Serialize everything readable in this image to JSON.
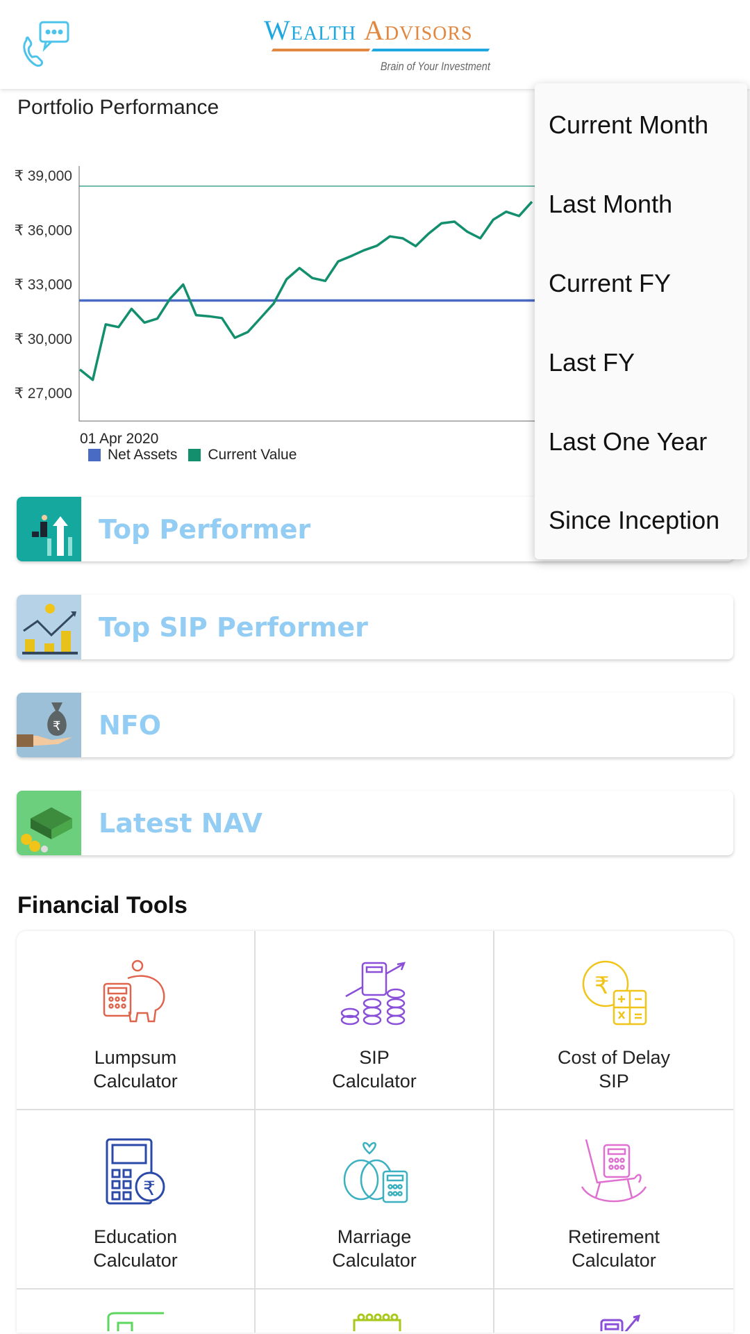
{
  "header": {
    "logo_word1": "Wealth",
    "logo_word2": "Advisors",
    "logo_tagline": "Brain of Your Investment",
    "call_icon": "phone-chat-icon"
  },
  "chart_title": "Portfolio Performance",
  "chart_data": {
    "type": "line",
    "y_ticks": [
      "₹ 39,000",
      "₹ 36,000",
      "₹ 33,000",
      "₹ 30,000",
      "₹ 27,000"
    ],
    "ylim": [
      25500,
      39600
    ],
    "x_tick_labels": [
      "01 Apr 2020"
    ],
    "grid": false,
    "legend_position": "bottom-left",
    "series": [
      {
        "name": "Net Assets",
        "color": "#4a6bc4",
        "values": [
          32080
        ]
      },
      {
        "name": "Current Value",
        "color": "#138f6e",
        "values": [
          28270,
          27700,
          30760,
          30610,
          31620,
          30860,
          31080,
          32190,
          32960,
          31270,
          31210,
          31110,
          30020,
          30340,
          31120,
          31910,
          33250,
          33870,
          33320,
          33160,
          34240,
          34530,
          34850,
          35100,
          35620,
          35510,
          35080,
          35770,
          36340,
          36430,
          35870,
          35510,
          36540,
          36980,
          36740,
          37530
        ]
      }
    ],
    "reference_line": {
      "value": 38390,
      "color": "#138f6e"
    }
  },
  "period_menu": {
    "items": [
      "Current Month",
      "Last Month",
      "Current FY",
      "Last FY",
      "Last One Year",
      "Since Inception"
    ]
  },
  "cards": [
    {
      "label": "Top Performer",
      "icon": "businessman-growth-icon",
      "bg": "#14a89e"
    },
    {
      "label": "Top SIP Performer",
      "icon": "coins-growth-icon",
      "bg": "#b5d2e6"
    },
    {
      "label": "NFO",
      "icon": "money-bag-icon",
      "bg": "#9cc0d8"
    },
    {
      "label": "Latest NAV",
      "icon": "cash-stack-icon",
      "bg": "#6ccf7e"
    }
  ],
  "financial_tools": {
    "title": "Financial Tools",
    "items": [
      {
        "label": "Lumpsum\nCalculator",
        "icon": "piggy-bank-calculator-icon",
        "color": "#e0634c"
      },
      {
        "label": "SIP\nCalculator",
        "icon": "coins-calculator-icon",
        "color": "#8a4fd8"
      },
      {
        "label": "Cost of Delay\nSIP",
        "icon": "rupee-calculator-icon",
        "color": "#f0c419"
      },
      {
        "label": "Education\nCalculator",
        "icon": "calculator-rupee-icon",
        "color": "#2b4aa8"
      },
      {
        "label": "Marriage\nCalculator",
        "icon": "rings-calculator-icon",
        "color": "#3ab0c0"
      },
      {
        "label": "Retirement\nCalculator",
        "icon": "rocking-chair-icon",
        "color": "#e070d0"
      },
      {
        "label": "",
        "icon": "tool-icon-7",
        "color": "#5cd65c"
      },
      {
        "label": "",
        "icon": "tool-icon-8",
        "color": "#a8c81e"
      },
      {
        "label": "",
        "icon": "tool-icon-9",
        "color": "#8a4fd8"
      }
    ]
  }
}
